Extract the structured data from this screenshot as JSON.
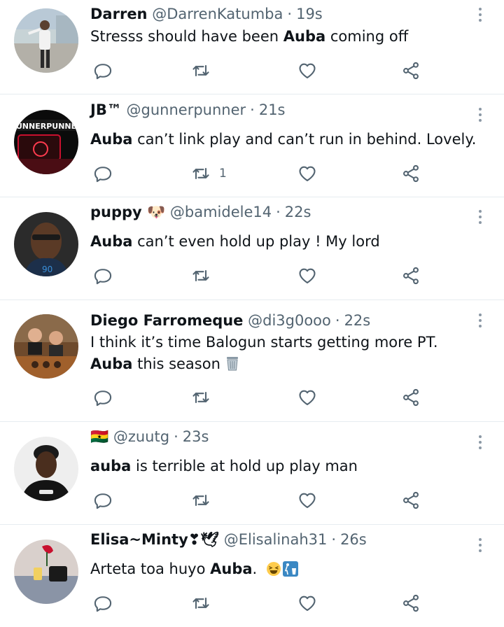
{
  "colors": {
    "text": "#0f1419",
    "muted": "#536471",
    "divider": "#e6ecf0",
    "icon": "#536471"
  },
  "icons": {
    "reply": "reply-bubble-icon",
    "retweet": "retweet-arrows-icon",
    "like": "heart-outline-icon",
    "share": "share-nodes-icon",
    "more": "vertical-dots-icon"
  },
  "tweets": [
    {
      "name": "Darren",
      "handle": "@DarrenKatumba",
      "time": "19s",
      "text_before": "Stresss should have been ",
      "text_bold": "Auba",
      "text_after": " coming off",
      "retweets": ""
    },
    {
      "name": "JB™",
      "handle": "@gunnerpunner",
      "time": "21s",
      "text_before": "",
      "text_bold": "Auba",
      "text_after": " can’t link play and can’t run in behind. Lovely.",
      "retweets": "1"
    },
    {
      "name": "puppy 🐶",
      "handle": "@bamidele14",
      "time": "22s",
      "text_before": "",
      "text_bold": "Auba",
      "text_after": " can’t even hold up play ! My lord",
      "retweets": ""
    },
    {
      "name": "Diego Farromeque",
      "handle": "@di3g0ooo",
      "time": "22s",
      "text_before": "I think it’s time Balogun starts getting more PT. ",
      "text_bold": "Auba",
      "text_after": " this season",
      "retweets": ""
    },
    {
      "name": "🇬🇭",
      "handle": "@zuutg",
      "time": "23s",
      "text_before": "",
      "text_bold": "auba",
      "text_after": " is terrible at hold up play man",
      "retweets": ""
    },
    {
      "name": "Elisa~Minty❣🕊",
      "handle": "@Elisalinah31",
      "time": "26s",
      "text_before": "Arteta toa huyo ",
      "text_bold": "Auba",
      "text_after": ". ",
      "retweets": ""
    }
  ]
}
